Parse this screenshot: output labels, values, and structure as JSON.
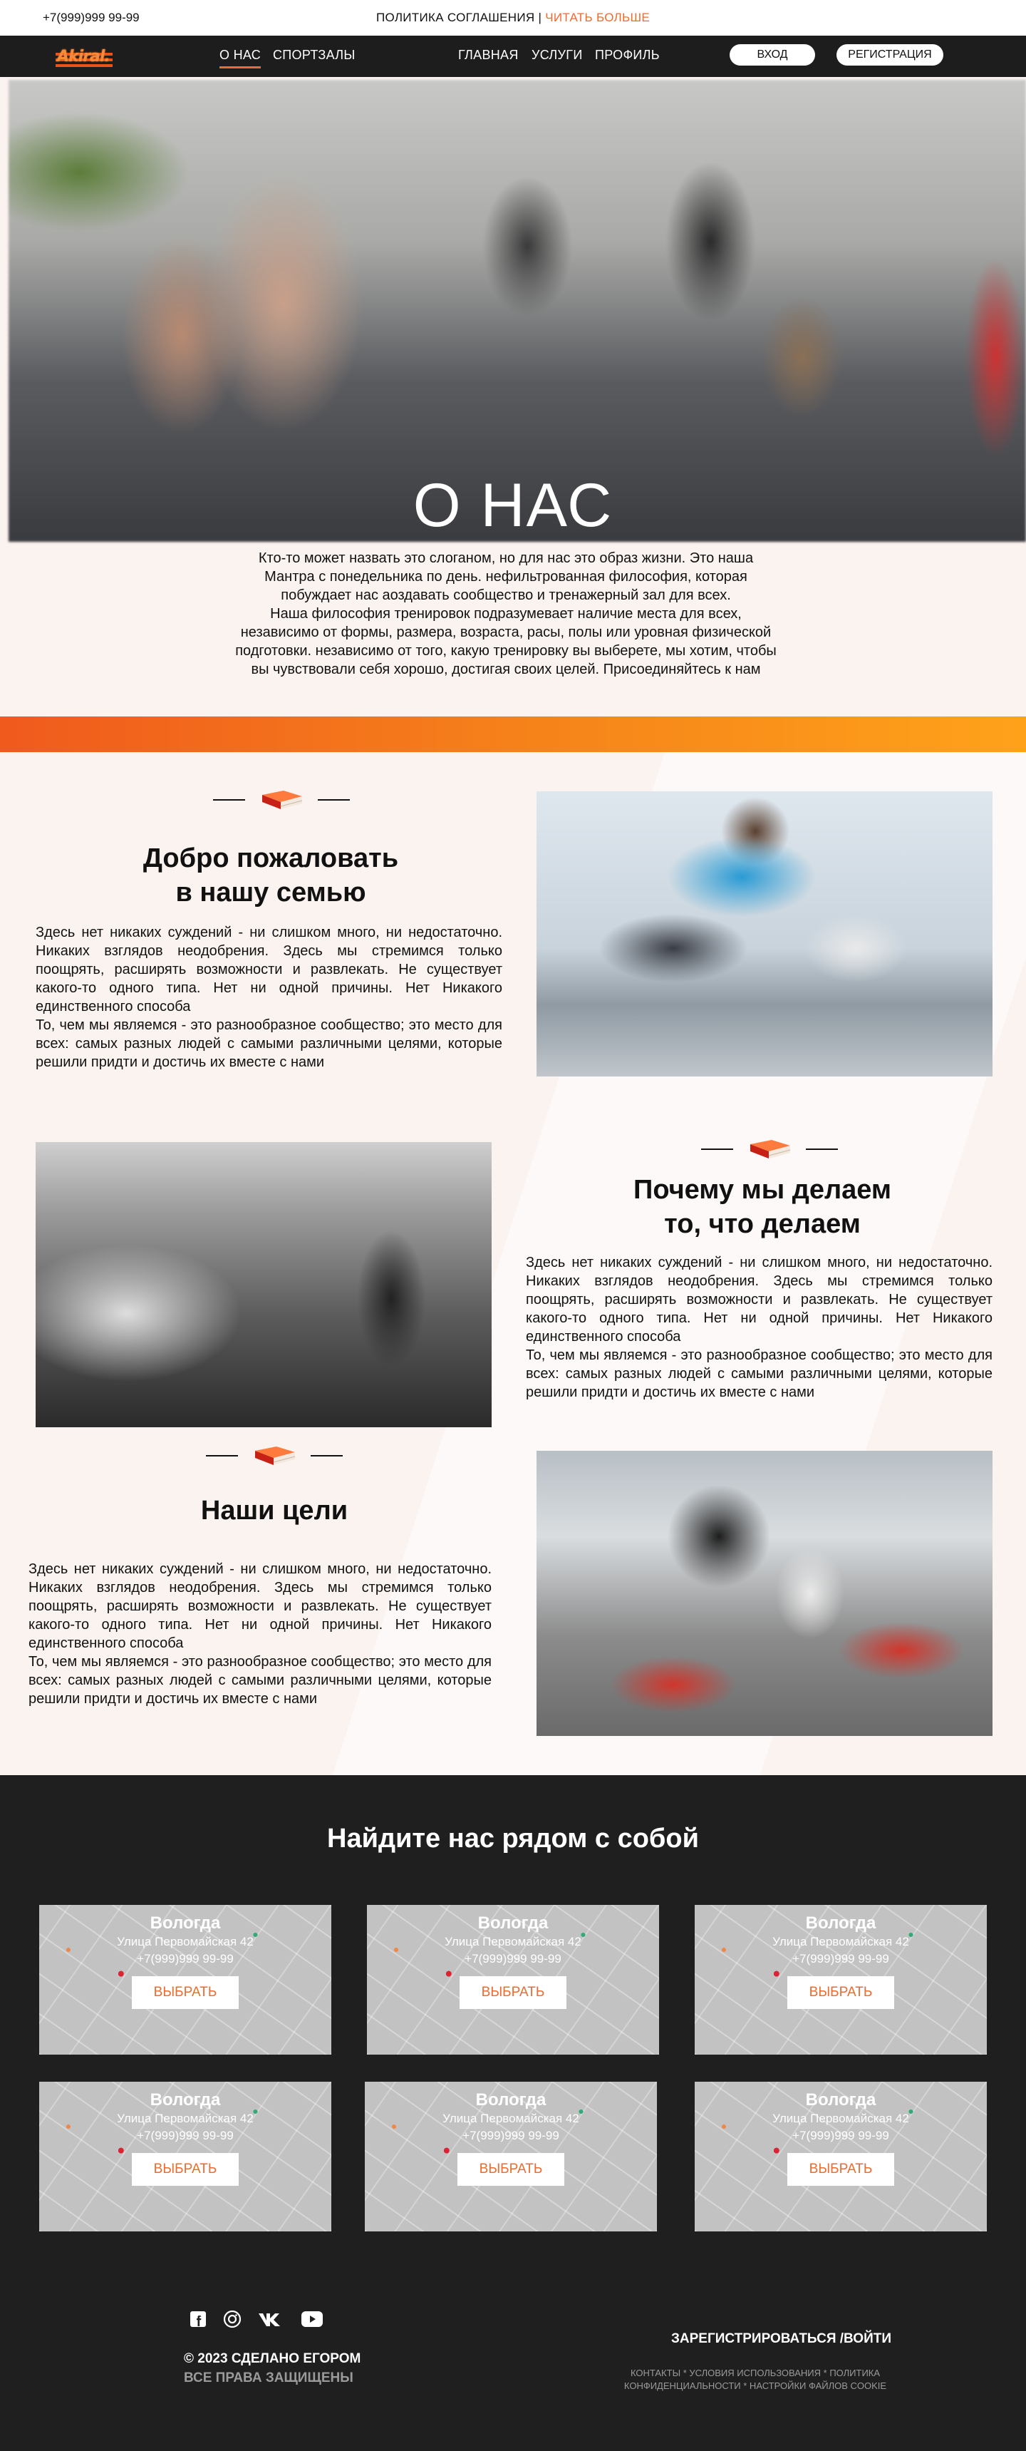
{
  "topbar": {
    "phone": "+7(999)999 99-99",
    "policy_text": "ПОЛИТИКА СОГЛАШЕНИЯ |",
    "policy_more": "ЧИТАТЬ БОЛЬШЕ"
  },
  "nav": {
    "logo": "Akiral.",
    "links": [
      "О НАС",
      "СПОРТЗАЛЫ",
      "ГЛАВНАЯ",
      "УСЛУГИ",
      "ПРОФИЛЬ"
    ],
    "login": "ВХОД",
    "register": "РЕГИСТРАЦИЯ"
  },
  "hero": {
    "title": "О НАС",
    "text_1": "Кто-то может назвать это слоганом, но для нас это образ жизни. Это наша Мантра с понедельника по день. нефильтрованная философия, которая побуждает нас аоздавать сообщество и тренажерный зал для всех.",
    "text_2": "Наша философия тренировок подразумевает наличие места для всех, независимо от формы, размера, возраста, расы, полы или уровная физической подготовки. независимо от того, какую тренировку вы выберете, мы хотим, чтобы вы чувствовали себя хорошо, достигая своих целей. Присоединяйтесь к нам"
  },
  "blocks": [
    {
      "title_1": "Добро пожаловать",
      "title_2": "в нашу семью",
      "p1": "Здесь нет никаких суждений - ни слишком много, ни недостаточно. Никаких взглядов неодобрения. Здесь мы стремимся только поощрять, расширять возможности и развлекать. Не существует какого-то одного типа. Нет ни одной причины. Нет Никакого единственного способа",
      "p2": "То, чем мы являемся - это разнообразное сообщество; это место для всех: самых разных людей с самыми различными целями, которые решили придти и достичь их вместе с нами"
    },
    {
      "title_1": "Почему мы делаем",
      "title_2": "то, что делаем",
      "p1": "Здесь нет никаких суждений - ни слишком много, ни недостаточно. Никаких взглядов неодобрения. Здесь мы стремимся только поощрять, расширять возможности и развлекать. Не существует какого-то одного типа. Нет ни одной причины. Нет Никакого единственного способа",
      "p2": "То, чем мы являемся - это разнообразное сообщество; это место для всех: самых разных людей с самыми различными целями, которые решили придти и достичь их вместе с нами"
    },
    {
      "title_1": "Наши цели",
      "title_2": "",
      "p1": "Здесь нет никаких суждений - ни слишком много, ни недостаточно. Никаких взглядов неодобрения. Здесь мы стремимся только поощрять, расширять возможности и развлекать. Не существует какого-то одного типа. Нет ни одной причины. Нет Никакого единственного способа",
      "p2": "То, чем мы являемся - это разнообразное сообщество; это место для всех: самых разных людей с самыми различными целями, которые решили придти и достичь их вместе с нами"
    }
  ],
  "find": {
    "title": "Найдите нас рядом с собой",
    "cards": [
      {
        "city": "Вологда",
        "address": "Улица Первомайская 42",
        "phone": "+7(999)999 99-99",
        "button": "ВЫБРАТЬ"
      },
      {
        "city": "Вологда",
        "address": "Улица Первомайская 42",
        "phone": "+7(999)999 99-99",
        "button": "ВЫБРАТЬ"
      },
      {
        "city": "Вологда",
        "address": "Улица Первомайская 42",
        "phone": "+7(999)999 99-99",
        "button": "ВЫБРАТЬ"
      },
      {
        "city": "Вологда",
        "address": "Улица Первомайская 42",
        "phone": "+7(999)999 99-99",
        "button": "ВЫБРАТЬ"
      },
      {
        "city": "Вологда",
        "address": "Улица Первомайская 42",
        "phone": "+7(999)999 99-99",
        "button": "ВЫБРАТЬ"
      },
      {
        "city": "Вологда",
        "address": "Улица Первомайская 42",
        "phone": "+7(999)999 99-99",
        "button": "ВЫБРАТЬ"
      }
    ]
  },
  "footer": {
    "socials": [
      "facebook-icon",
      "instagram-icon",
      "vk-icon",
      "youtube-icon"
    ],
    "copyright": "© 2023 СДЕЛАНО ЕГОРОМ",
    "rights": "ВСЕ ПРАВА ЗАЩИЩЕНЫ",
    "register_login": "ЗАРЕГИСТРИРОВАТЬСЯ /ВОЙТИ",
    "links_1": "КОНТАКТЫ * УСЛОВИЯ ИСПОЛЬЗОВАНИЯ * ПОЛИТИКА",
    "links_2": "КОНФИДЕНЦИАЛЬНОСТИ * НАСТРОЙКИ ФАЙЛОВ COOKIE"
  },
  "colors": {
    "accent": "#ef6a2e",
    "dark": "#1d1d1d",
    "background": "#fbf3f0"
  }
}
